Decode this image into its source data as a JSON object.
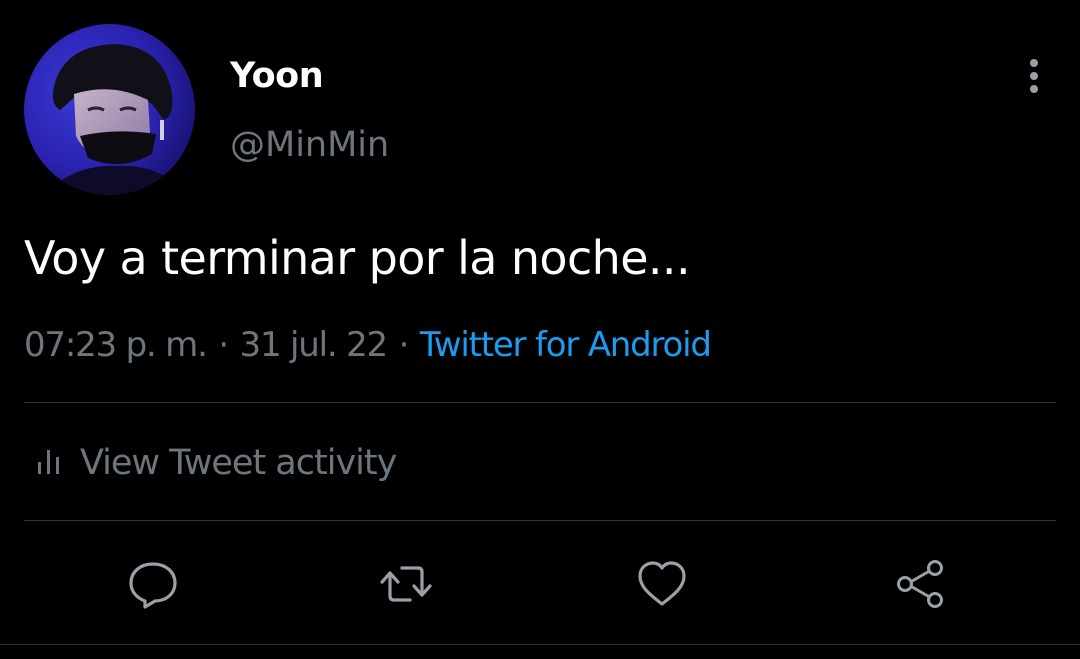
{
  "user": {
    "display_name": "Yoon",
    "handle": "@MinMin",
    "avatar_icon": "profile-photo"
  },
  "tweet": {
    "text": "Voy a terminar por la noche...",
    "time": "07:23 p. m.",
    "separator": "·",
    "date": "31 jul. 22",
    "source": "Twitter for Android"
  },
  "activity": {
    "icon": "bar-chart-icon",
    "label": "View Tweet activity"
  },
  "actions": [
    {
      "name": "reply",
      "icon": "comment-icon"
    },
    {
      "name": "retweet",
      "icon": "retweet-icon"
    },
    {
      "name": "like",
      "icon": "heart-icon"
    },
    {
      "name": "share",
      "icon": "share-icon"
    }
  ],
  "colors": {
    "background": "#000000",
    "primary_text": "#ffffff",
    "secondary_text": "#6e767d",
    "link": "#1d9bf0",
    "divider": "#2f3336"
  }
}
